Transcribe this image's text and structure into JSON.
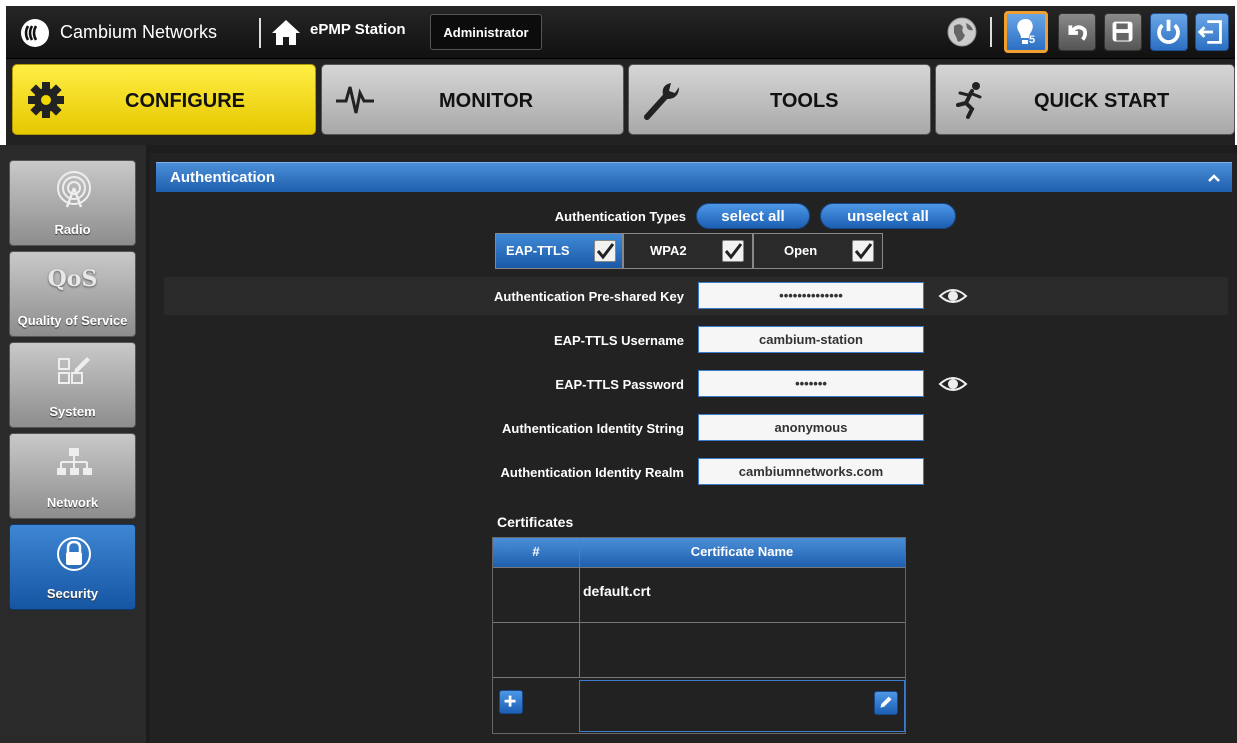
{
  "header": {
    "brand": "Cambium Networks",
    "station": "ePMP Station",
    "role": "Administrator",
    "notification_count": "5"
  },
  "main_tabs": [
    {
      "label": "CONFIGURE",
      "icon": "gear-icon",
      "active": true
    },
    {
      "label": "MONITOR",
      "icon": "pulse-icon",
      "active": false
    },
    {
      "label": "TOOLS",
      "icon": "wrench-icon",
      "active": false
    },
    {
      "label": "QUICK START",
      "icon": "runner-icon",
      "active": false
    }
  ],
  "sidebar": {
    "items": [
      {
        "label": "Radio",
        "icon": "antenna-icon"
      },
      {
        "label": "Quality of Service",
        "icon": "qos-icon",
        "icon_text": "QoS"
      },
      {
        "label": "System",
        "icon": "system-icon"
      },
      {
        "label": "Network",
        "icon": "network-icon"
      },
      {
        "label": "Security",
        "icon": "lock-icon",
        "active": true
      }
    ]
  },
  "panel": {
    "title": "Authentication",
    "auth_types_label": "Authentication Types",
    "select_all": "select all",
    "unselect_all": "unselect all",
    "types": [
      {
        "label": "EAP-TTLS",
        "checked": true
      },
      {
        "label": "WPA2",
        "checked": true
      },
      {
        "label": "Open",
        "checked": true
      }
    ],
    "fields": [
      {
        "label": "Authentication Pre-shared Key",
        "value": "••••••••••••••",
        "reveal": true
      },
      {
        "label": "EAP-TTLS Username",
        "value": "cambium-station",
        "reveal": false
      },
      {
        "label": "EAP-TTLS Password",
        "value": "•••••••",
        "reveal": true
      },
      {
        "label": "Authentication Identity String",
        "value": "anonymous",
        "reveal": false
      },
      {
        "label": "Authentication Identity Realm",
        "value": "cambiumnetworks.com",
        "reveal": false
      }
    ],
    "certificates": {
      "title": "Certificates",
      "columns": [
        "#",
        "Certificate Name"
      ],
      "rows": [
        {
          "num": "",
          "name": "default.crt"
        },
        {
          "num": "",
          "name": ""
        }
      ]
    }
  },
  "colors": {
    "accent_blue": "#2c6fc3",
    "configure_yellow": "#ffee44",
    "background_dark": "#222222"
  }
}
